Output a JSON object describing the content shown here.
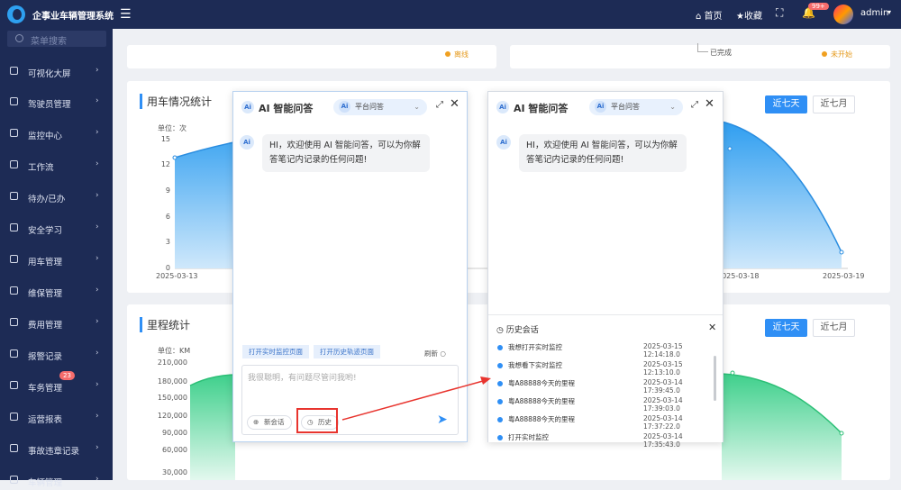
{
  "app": {
    "title": "企事业车辆管理系统"
  },
  "topbar": {
    "home": "首页",
    "fav": "收藏",
    "notif_count": "99+",
    "user": "admin"
  },
  "sidebar": {
    "search_placeholder": "菜单搜索",
    "items": [
      {
        "label": "可视化大屏"
      },
      {
        "label": "驾驶员管理"
      },
      {
        "label": "监控中心"
      },
      {
        "label": "工作流"
      },
      {
        "label": "待办/已办"
      },
      {
        "label": "安全学习"
      },
      {
        "label": "用车管理"
      },
      {
        "label": "维保管理"
      },
      {
        "label": "费用管理"
      },
      {
        "label": "报警记录"
      },
      {
        "label": "车务管理",
        "badge": "23"
      },
      {
        "label": "运营报表"
      },
      {
        "label": "事故违章记录"
      },
      {
        "label": "车辆管理"
      }
    ]
  },
  "top_cards": {
    "left_status": "离线",
    "right_done": "已完成",
    "right_status": "未开始"
  },
  "usage_chart": {
    "title": "用车情况统计",
    "unit": "单位：次",
    "btn_week": "近七天",
    "btn_month": "近七月",
    "y_ticks": [
      "15",
      "12",
      "9",
      "6",
      "3",
      "0"
    ],
    "x_ticks": [
      "2025-03-13",
      "2025-03-18",
      "2025-03-19"
    ]
  },
  "mileage_chart": {
    "title": "里程统计",
    "unit": "单位：KM",
    "btn_week": "近七天",
    "btn_month": "近七月",
    "y_ticks": [
      "210,000",
      "180,000",
      "150,000",
      "120,000",
      "90,000",
      "60,000",
      "30,000"
    ]
  },
  "chat_left": {
    "title": "AI 智能问答",
    "mode": "平台问答",
    "ai_label": "Ai",
    "greeting": "HI，欢迎使用 AI 智能问答，可以为你解答笔记内记录的任何问题!",
    "chips": [
      "打开实时监控页面",
      "打开历史轨迹页面"
    ],
    "refresh": "刷新",
    "placeholder": "我很聪明，有问题尽管问我哟!",
    "new_session": "新会话",
    "history": "历史"
  },
  "chat_right": {
    "title": "AI 智能问答",
    "mode": "平台问答",
    "ai_label": "Ai",
    "greeting": "HI，欢迎使用 AI 智能问答，可以为你解答笔记内记录的任何问题!",
    "history_title": "历史会话",
    "history": [
      {
        "text": "我想打开实时监控",
        "time": "2025-03-15 12:14:18.0"
      },
      {
        "text": "我想看下实时监控",
        "time": "2025-03-15 12:13:10.0"
      },
      {
        "text": "粤A88888今天的里程",
        "time": "2025-03-14 17:39:45.0"
      },
      {
        "text": "粤A88888今天的里程",
        "time": "2025-03-14 17:39:03.0"
      },
      {
        "text": "粤A88888今天的里程",
        "time": "2025-03-14 17:37:22.0"
      },
      {
        "text": "打开实时监控",
        "time": "2025-03-14 17:35:43.0"
      }
    ]
  },
  "colors": {
    "nav": "#1d2b55",
    "accent": "#2f8ff5",
    "usage_fill": "#2f9ef0",
    "mileage_fill": "#3fd08c",
    "arrow": "#e8342e"
  }
}
